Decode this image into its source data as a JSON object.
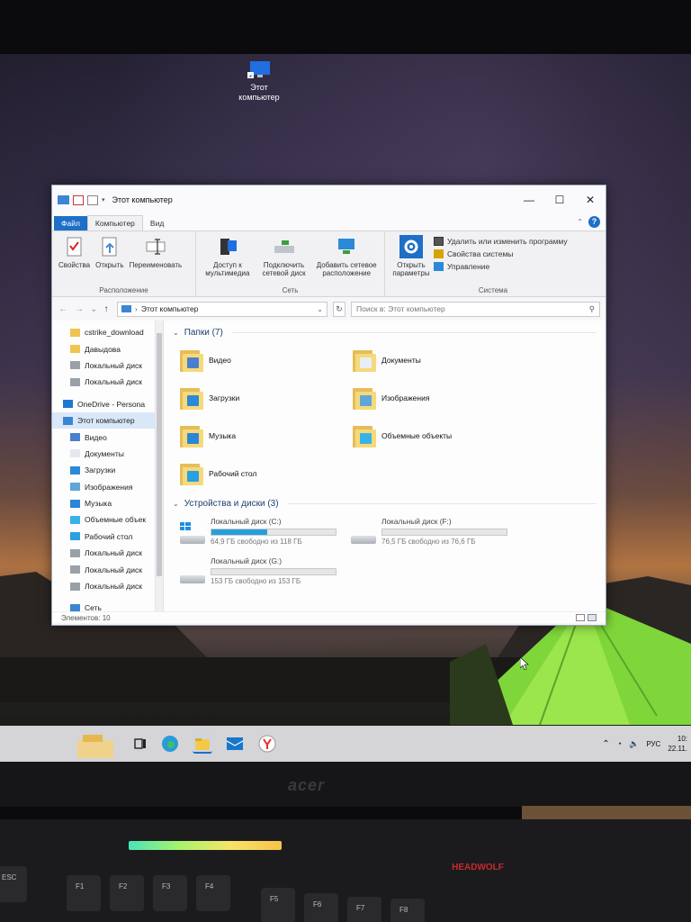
{
  "desktop": {
    "icon_label": "Этот\nкомпьютер"
  },
  "window": {
    "title": "Этот компьютер",
    "controls": {
      "minimize": "—",
      "maximize": "☐",
      "close": "✕"
    }
  },
  "ribbon": {
    "tabs": [
      "Файл",
      "Компьютер",
      "Вид"
    ],
    "groups": {
      "location": {
        "label": "Расположение",
        "buttons": [
          "Свойства",
          "Открыть",
          "Переименовать"
        ]
      },
      "network": {
        "label": "Сеть",
        "buttons": [
          "Доступ к мультимедиа",
          "Подключить сетевой диск",
          "Добавить сетевое расположение"
        ]
      },
      "system": {
        "label": "Система",
        "open_settings": "Открыть параметры",
        "items": [
          "Удалить или изменить программу",
          "Свойства системы",
          "Управление"
        ]
      }
    }
  },
  "address": {
    "path": "Этот компьютер",
    "search_placeholder": "Поиск в: Этот компьютер"
  },
  "nav": {
    "items": [
      {
        "label": "cstrike_download",
        "icon": "folder-icon",
        "indent": 1
      },
      {
        "label": "Давыдова",
        "icon": "folder-icon",
        "indent": 1
      },
      {
        "label": "Локальный диск",
        "icon": "drive-icon",
        "indent": 1
      },
      {
        "label": "Локальный диск",
        "icon": "drive-icon",
        "indent": 1
      },
      {
        "label": "OneDrive - Persona",
        "icon": "cloud-icon",
        "indent": 0
      },
      {
        "label": "Этот компьютер",
        "icon": "computer-icon",
        "indent": 0,
        "selected": true
      },
      {
        "label": "Видео",
        "icon": "video-icon",
        "indent": 1
      },
      {
        "label": "Документы",
        "icon": "document-icon",
        "indent": 1
      },
      {
        "label": "Загрузки",
        "icon": "download-icon",
        "indent": 1
      },
      {
        "label": "Изображения",
        "icon": "image-icon",
        "indent": 1
      },
      {
        "label": "Музыка",
        "icon": "music-icon",
        "indent": 1
      },
      {
        "label": "Объемные объек",
        "icon": "cube-icon",
        "indent": 1
      },
      {
        "label": "Рабочий стол",
        "icon": "desktop-icon",
        "indent": 1
      },
      {
        "label": "Локальный диск",
        "icon": "drive-icon",
        "indent": 1
      },
      {
        "label": "Локальный диск",
        "icon": "drive-icon",
        "indent": 1
      },
      {
        "label": "Локальный диск",
        "icon": "drive-icon",
        "indent": 1
      },
      {
        "label": "Сеть",
        "icon": "network-icon",
        "indent": 1
      }
    ]
  },
  "folders": {
    "header": "Папки (7)",
    "items": [
      {
        "label": "Видео",
        "badge": "#4a7fd0"
      },
      {
        "label": "Документы",
        "badge": "#e9eef5"
      },
      {
        "label": "Загрузки",
        "badge": "#2a8ad8"
      },
      {
        "label": "Изображения",
        "badge": "#5fa6d9"
      },
      {
        "label": "Музыка",
        "badge": "#2b86d6"
      },
      {
        "label": "Объемные объекты",
        "badge": "#39b3e6"
      },
      {
        "label": "Рабочий стол",
        "badge": "#2aa0e0"
      }
    ]
  },
  "drives": {
    "header": "Устройства и диски (3)",
    "items": [
      {
        "label": "Локальный диск (C:)",
        "free": "64,9 ГБ свободно из 118 ГБ",
        "used_fraction": 0.45,
        "system": true
      },
      {
        "label": "Локальный диск (F:)",
        "free": "76,5 ГБ свободно из 76,6 ГБ",
        "used_fraction": 0.0,
        "system": false
      },
      {
        "label": "Локальный диск (G:)",
        "free": "153 ГБ свободно из 153 ГБ",
        "used_fraction": 0.0,
        "system": false
      }
    ]
  },
  "status": {
    "count": "Элементов: 10"
  },
  "taskbar": {
    "tray_lang": "РУС",
    "clock_time": "10:",
    "clock_date": "22.11."
  },
  "hardware": {
    "brand": "acer",
    "keyboard_logo": "HEADWOLF",
    "keys": [
      "ESC",
      "F1",
      "F2",
      "F3",
      "F4",
      "F5",
      "F6",
      "F7",
      "F8"
    ]
  },
  "colors": {
    "accent": "#1e6fc7",
    "progress": "#26a0da",
    "tent": "#7fd63a"
  }
}
